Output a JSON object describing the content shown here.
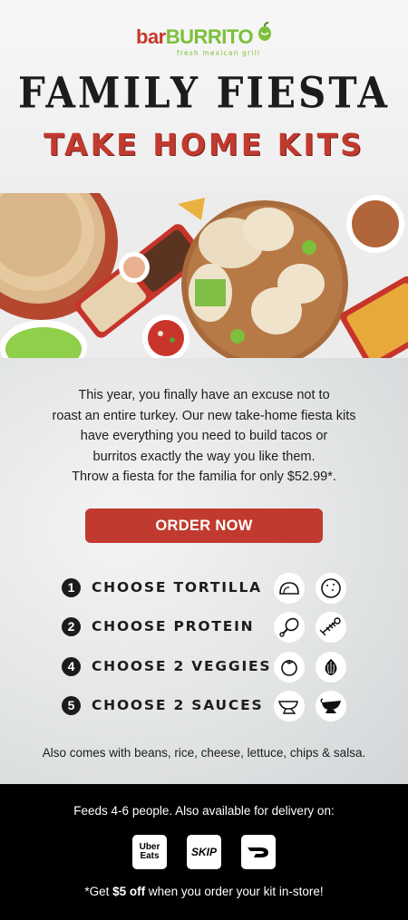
{
  "brand": {
    "name_part1": "bar",
    "name_part2": "BURRITO",
    "tagline": "fresh mexican grill",
    "colors": {
      "red": "#c13a2f",
      "green": "#7cbf3a",
      "dark": "#1c1c1c"
    }
  },
  "header": {
    "title": "FAMILY FIESTA",
    "subtitle": "TAKE HOME KITS"
  },
  "intro": {
    "lines": [
      "This year, you finally have an excuse not to",
      "roast an entire turkey. Our new take-home fiesta kits",
      "have everything you need to build tacos or",
      "burritos exactly the way you like them.",
      "Throw a fiesta for the familia for only $52.99*."
    ]
  },
  "cta": {
    "label": "ORDER NOW"
  },
  "steps": [
    {
      "number": "1",
      "label": "CHOOSE TORTILLA",
      "icons": [
        "taco-shell-icon",
        "tortilla-icon"
      ]
    },
    {
      "number": "2",
      "label": "CHOOSE PROTEIN",
      "icons": [
        "chicken-leg-icon",
        "fish-icon"
      ]
    },
    {
      "number": "4",
      "label": "CHOOSE 2 VEGGIES",
      "icons": [
        "tomato-icon",
        "onion-icon"
      ]
    },
    {
      "number": "5",
      "label": "CHOOSE 2 SAUCES",
      "icons": [
        "sauce-boat-icon",
        "gravy-boat-icon"
      ]
    }
  ],
  "also": "Also comes with beans, rice, cheese, lettuce, chips & salsa.",
  "footer": {
    "feeds": "Feeds 4-6 people. Also available for delivery on:",
    "delivery": [
      {
        "name": "Uber Eats",
        "line1": "Uber",
        "line2": "Eats",
        "icon": "uber-eats-icon"
      },
      {
        "name": "SkipTheDishes",
        "text": "SKIP",
        "icon": "skip-icon"
      },
      {
        "name": "DoorDash",
        "icon": "doordash-icon"
      }
    ],
    "coupon_pre": "*Get ",
    "coupon_bold": "$5 off",
    "coupon_post": " when you order your kit in-store!"
  }
}
